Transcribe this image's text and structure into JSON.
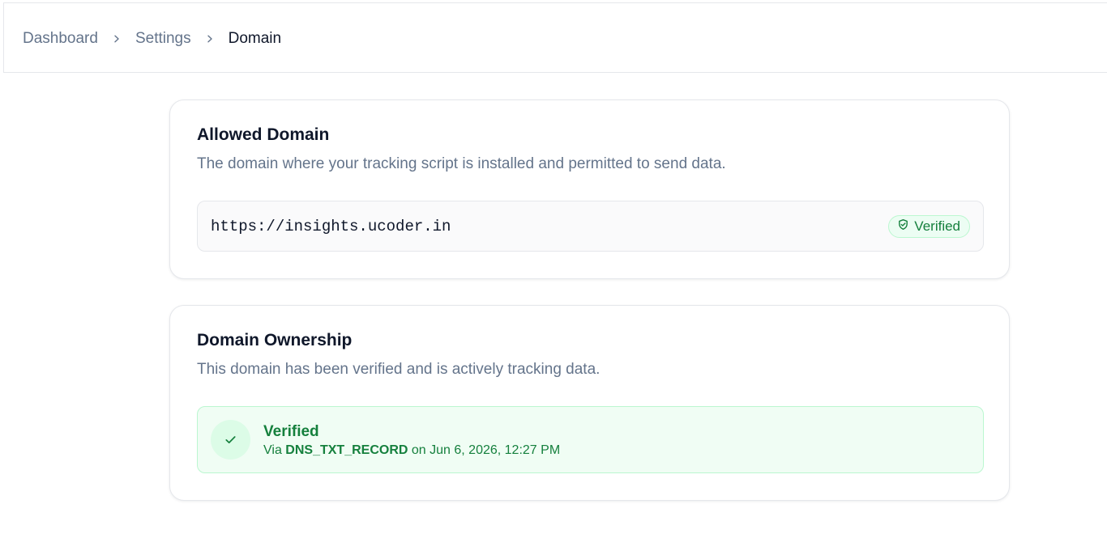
{
  "breadcrumb": {
    "items": [
      {
        "label": "Dashboard"
      },
      {
        "label": "Settings"
      },
      {
        "label": "Domain"
      }
    ]
  },
  "allowed_domain": {
    "title": "Allowed Domain",
    "description": "The domain where your tracking script is installed and permitted to send data.",
    "url": "https://insights.ucoder.in",
    "badge_label": "Verified",
    "badge_icon": "shield-check-icon"
  },
  "ownership": {
    "title": "Domain Ownership",
    "description": "This domain has been verified and is actively tracking data.",
    "status_title": "Verified",
    "status_icon": "check-icon",
    "via_label": "Via",
    "method": "DNS_TXT_RECORD",
    "on_label": "on",
    "verified_at": "Jun 6, 2026, 12:27 PM"
  },
  "colors": {
    "success_text": "#15803d",
    "success_background": "#f0fdf4",
    "success_border": "#bbf7d0",
    "muted_text": "#64748b",
    "card_border": "#e5e7eb"
  }
}
